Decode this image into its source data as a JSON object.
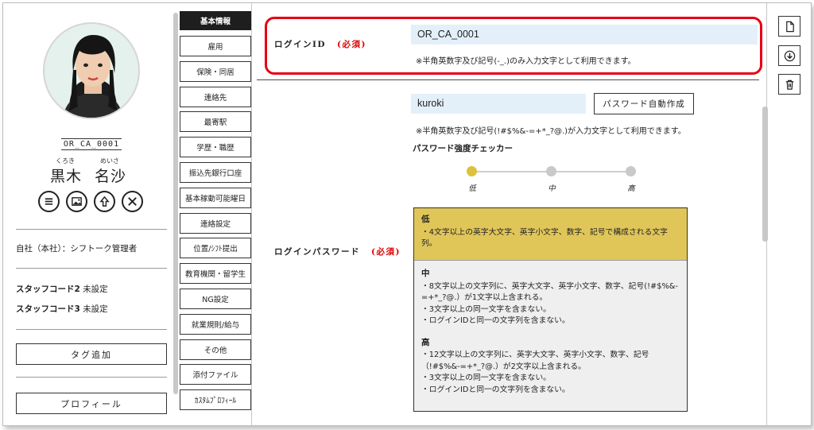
{
  "profile": {
    "staff_id": "OR_CA_0001",
    "kana_last": "くろき",
    "kana_first": "めいさ",
    "name_last": "黒木",
    "name_first": "名沙",
    "affiliation": "自社（本社）：シフトーク管理者",
    "code2_label": "スタッフコード2",
    "code2_value": "未設定",
    "code3_label": "スタッフコード3",
    "code3_value": "未設定",
    "tag_button": "タグ追加",
    "profile_button": "プロフィール"
  },
  "tabs": [
    {
      "label": "基本情報",
      "active": true
    },
    {
      "label": "雇用"
    },
    {
      "label": "保険・同居"
    },
    {
      "label": "連絡先"
    },
    {
      "label": "最寄駅"
    },
    {
      "label": "学歴・職歴"
    },
    {
      "label": "振込先銀行口座"
    },
    {
      "label": "基本稼動可能曜日"
    },
    {
      "label": "連絡設定"
    },
    {
      "label": "位置/ｼﾌﾄ提出"
    },
    {
      "label": "教育機関・留学生"
    },
    {
      "label": "NG設定"
    },
    {
      "label": "就業規則/給与"
    },
    {
      "label": "その他"
    },
    {
      "label": "添付ファイル"
    },
    {
      "label": "ｶｽﾀﾑﾌﾟﾛﾌｨｰﾙ"
    }
  ],
  "login": {
    "label": "ログインID",
    "required": "(必須)",
    "value": "OR_CA_0001",
    "note": "※半角英数字及び記号(-_.)のみ入力文字として利用できます。"
  },
  "password": {
    "label": "ログインパスワード",
    "required": "(必須)",
    "value": "kuroki",
    "generate_button": "パスワード自動作成",
    "note": "※半角英数字及び記号(!#$%&-=+*_?@.)が入力文字として利用できます。",
    "checker_title": "パスワード強度チェッカー",
    "levels": [
      "低",
      "中",
      "高"
    ],
    "current_level": "低",
    "rules": {
      "low_title": "低",
      "low_items": [
        "・4文字以上の英字大文字、英字小文字、数字、記号で構成される文字列。"
      ],
      "mid_title": "中",
      "mid_items": [
        "・8文字以上の文字列に、英字大文字、英字小文字、数字、記号(!#$%&-=+*_?@.）が1文字以上含まれる。",
        "・3文字以上の同一文字を含まない。",
        "・ログインIDと同一の文字列を含まない。"
      ],
      "high_title": "高",
      "high_items": [
        "・12文字以上の文字列に、英字大文字、英字小文字、数字、記号（!#$%&-=+*_?@.）が2文字以上含まれる。",
        "・3文字以上の同一文字を含まない。",
        "・ログインIDと同一の文字列を含まない。"
      ]
    }
  },
  "colors": {
    "highlight": "#e60012",
    "required": "#e00000",
    "input_bg": "#e3f0fa",
    "strength_low": "#dcc23a"
  },
  "tools": [
    "new-document-icon",
    "download-icon",
    "trash-icon"
  ]
}
